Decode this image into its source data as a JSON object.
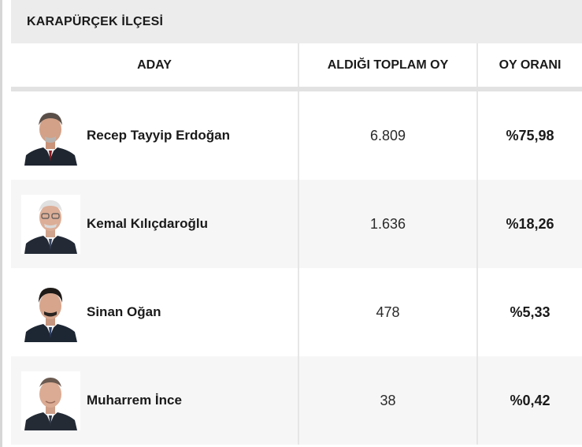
{
  "district_title": "KARAPÜRÇEK İLÇESİ",
  "columns": {
    "candidate": "ADAY",
    "total_votes": "ALDIĞI TOPLAM OY",
    "vote_share": "OY ORANI"
  },
  "rows": [
    {
      "name": "Recep Tayyip Erdoğan",
      "votes": "6.809",
      "share": "%75,98",
      "photo": "candidate-portrait-1"
    },
    {
      "name": "Kemal Kılıçdaroğlu",
      "votes": "1.636",
      "share": "%18,26",
      "photo": "candidate-portrait-2"
    },
    {
      "name": "Sinan Oğan",
      "votes": "478",
      "share": "%5,33",
      "photo": "candidate-portrait-3"
    },
    {
      "name": "Muharrem İnce",
      "votes": "38",
      "share": "%0,42",
      "photo": "candidate-portrait-4"
    }
  ],
  "colors": {
    "title_bar_bg": "#ececec",
    "alt_row_bg": "#f6f6f6",
    "header_rule": "#e2e2e2"
  }
}
